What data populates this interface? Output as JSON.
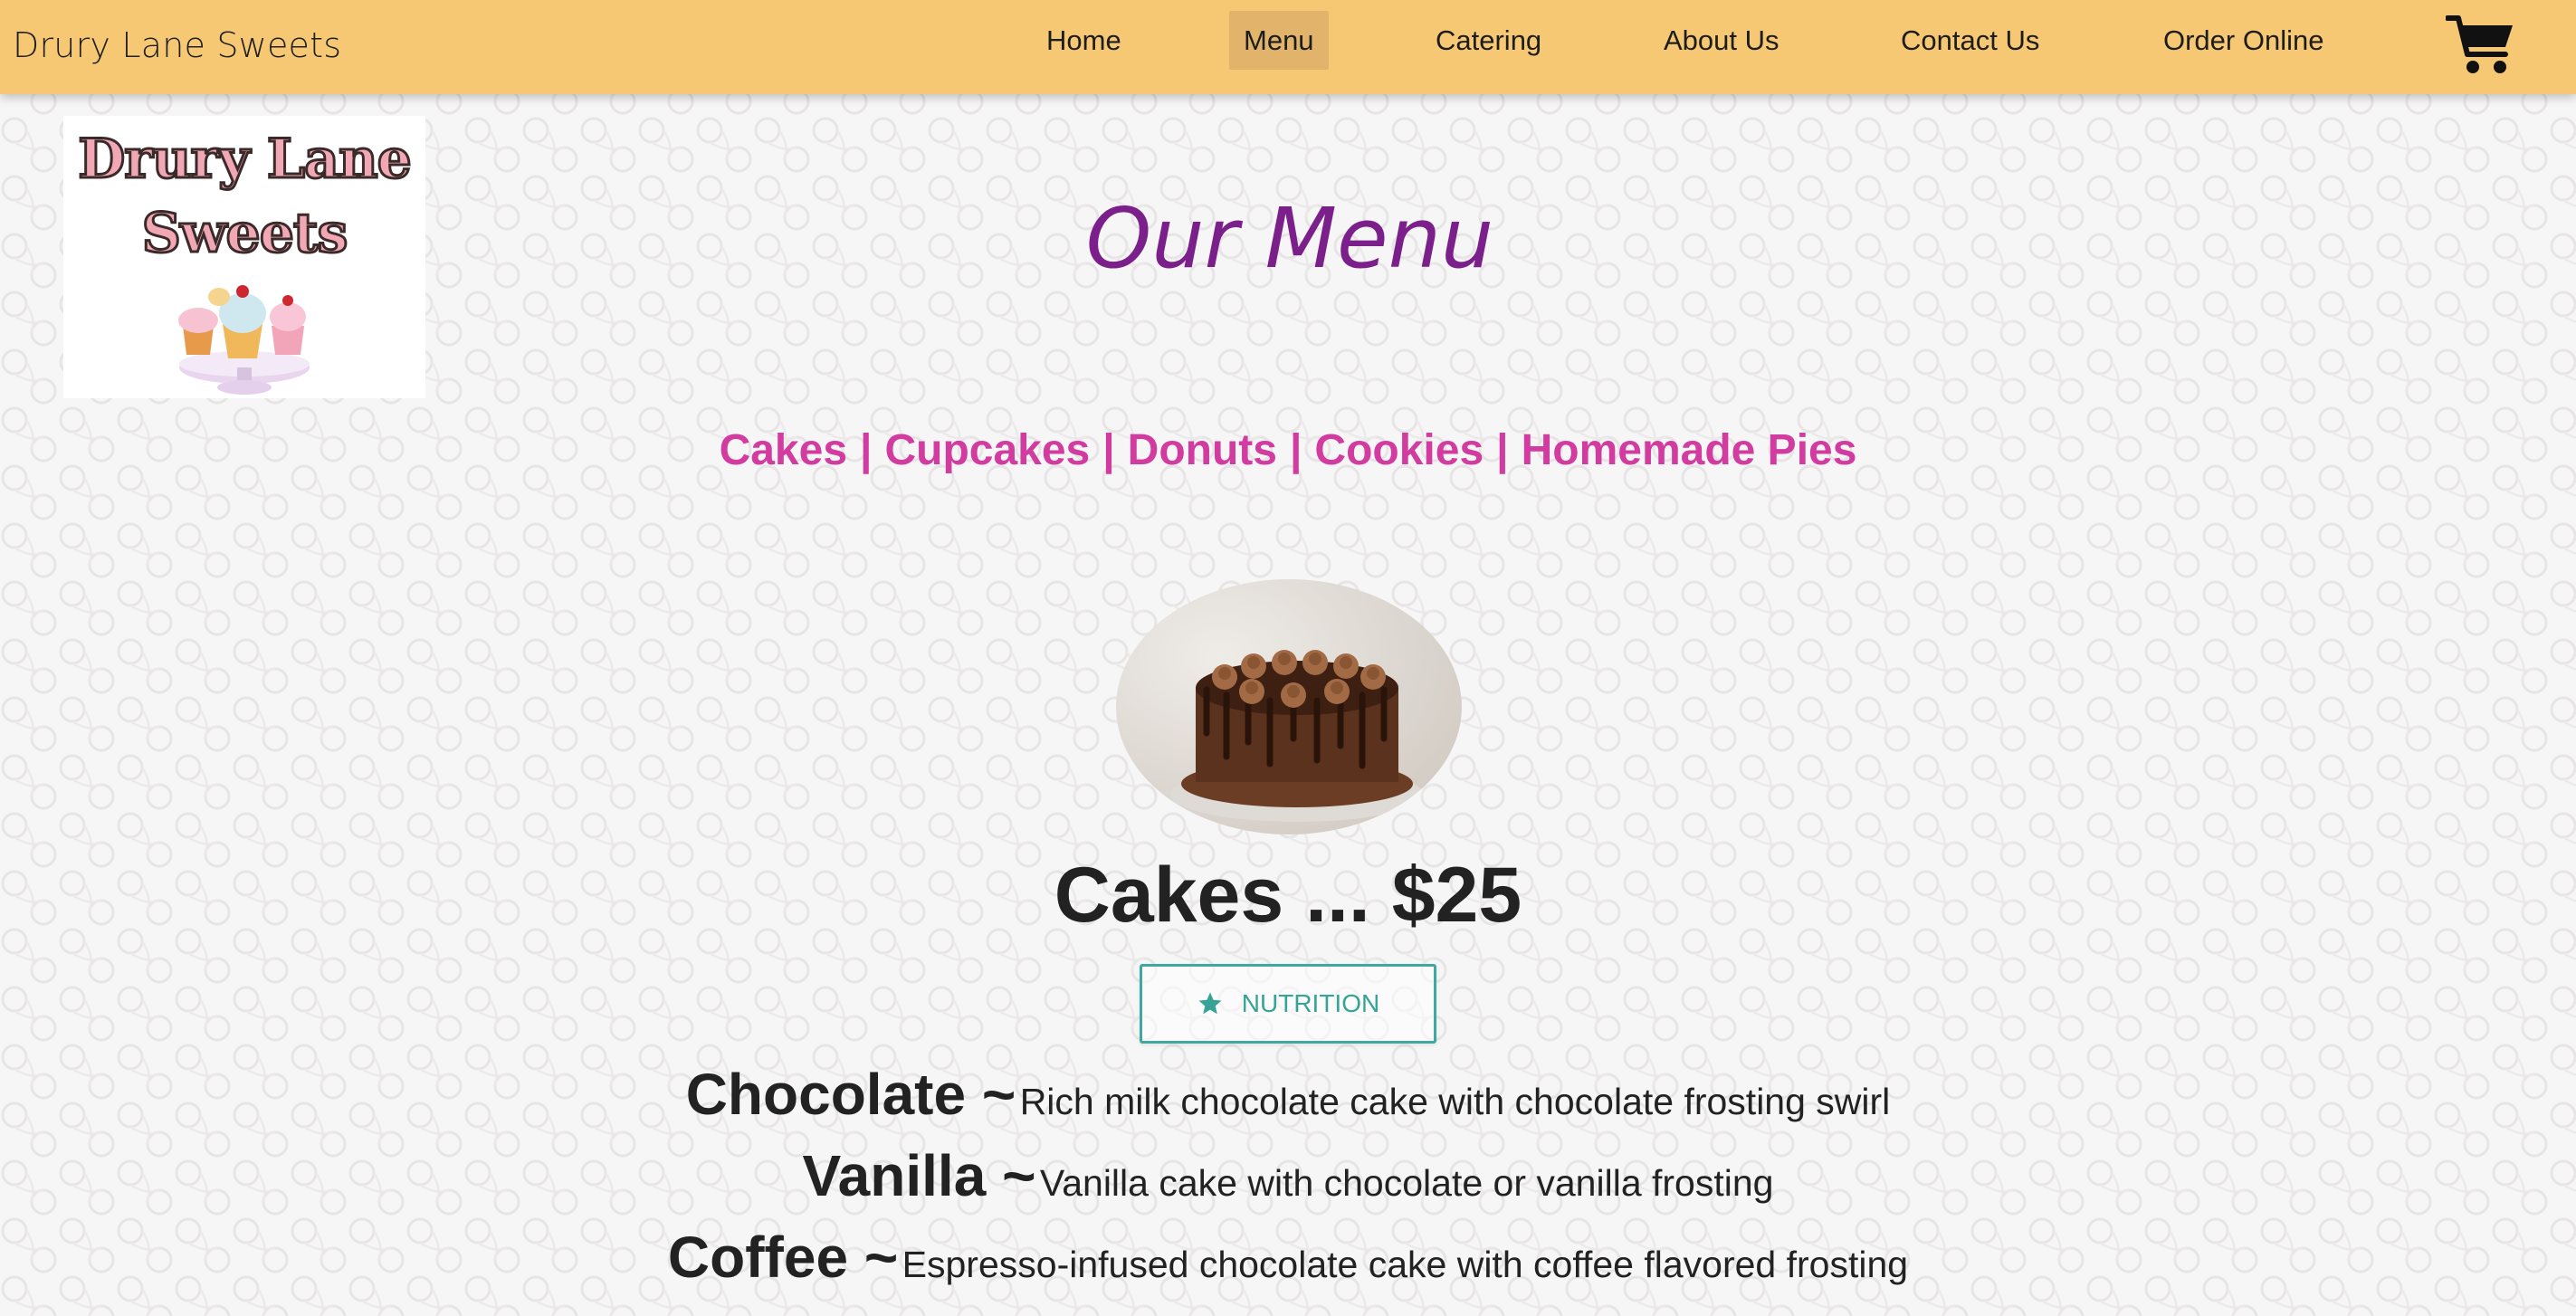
{
  "header": {
    "site_name": "Drury Lane Sweets",
    "nav": [
      {
        "label": "Home",
        "active": false
      },
      {
        "label": "Menu",
        "active": true
      },
      {
        "label": "Catering",
        "active": false
      },
      {
        "label": "About Us",
        "active": false
      },
      {
        "label": "Contact Us",
        "active": false
      },
      {
        "label": "Order Online",
        "active": false
      }
    ],
    "cart_icon": "shopping-cart-icon"
  },
  "logo": {
    "line1": "Drury Lane",
    "line2": "Sweets"
  },
  "main": {
    "title": "Our Menu",
    "categories": [
      "Cakes",
      "Cupcakes",
      "Donuts",
      "Cookies",
      "Homemade Pies"
    ],
    "category_separator": "|",
    "section": {
      "title": "Cakes ... $25",
      "nutrition_label": "NUTRITION",
      "nutrition_icon": "star-icon",
      "items": [
        {
          "name": "Chocolate ~",
          "description": "Rich milk chocolate cake with chocolate frosting swirl"
        },
        {
          "name": "Vanilla ~",
          "description": "Vanilla cake with chocolate or vanilla frosting"
        },
        {
          "name": "Coffee ~",
          "description": "Espresso-infused chocolate cake with coffee flavored frosting"
        }
      ]
    }
  },
  "colors": {
    "header_bg": "#f6c873",
    "nav_active_bg": "#e2b36b",
    "title": "#7b1f8a",
    "category_links": "#d23ba0",
    "button_accent": "#3fa9a0",
    "text": "#222222"
  }
}
